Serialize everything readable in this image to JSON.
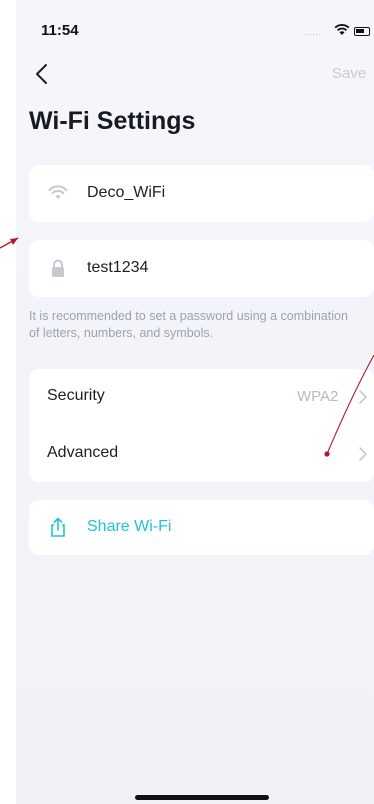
{
  "status_bar": {
    "time": "11:54",
    "signal": "....."
  },
  "nav": {
    "save_label": "Save"
  },
  "page": {
    "title": "Wi-Fi Settings"
  },
  "ssid": {
    "value": "Deco_WiFi"
  },
  "password": {
    "value": "test1234"
  },
  "hint": "It is recommended to set a password using a combination of letters, numbers, and symbols.",
  "settings": {
    "security_label": "Security",
    "security_value": "WPA2",
    "advanced_label": "Advanced"
  },
  "share": {
    "label": "Share Wi-Fi"
  },
  "colors": {
    "accent": "#22c3d6",
    "annotation": "#b0192a",
    "background": "#f5f6fa"
  },
  "icons": [
    "wifi-icon",
    "lock-icon",
    "chevron-right-icon",
    "share-icon",
    "back-chevron-icon"
  ]
}
